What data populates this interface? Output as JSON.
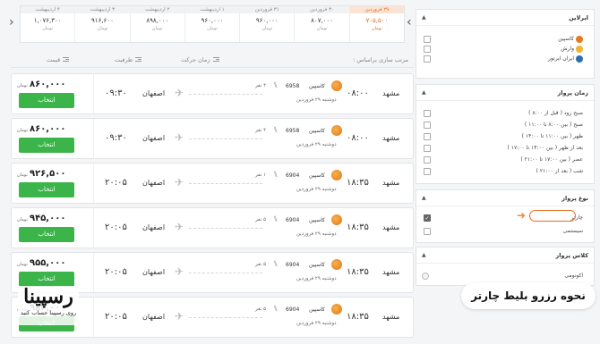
{
  "date_strip": {
    "cells": [
      {
        "date": "۲۹ فروردین",
        "price": "۷۰۵,۵۰۰",
        "currency": "تومان",
        "active": true
      },
      {
        "date": "۳۰ فروردین",
        "price": "۸۰۷,۰۰۰",
        "currency": "تومان",
        "active": false
      },
      {
        "date": "۳۱ فروردین",
        "price": "۹۶۰,۰۰۰",
        "currency": "تومان",
        "active": false
      },
      {
        "date": "۱ اردیبهشت",
        "price": "۹۶۰,۰۰۰",
        "currency": "تومان",
        "active": false
      },
      {
        "date": "۲ اردیبهشت",
        "price": "۸۹۸,۰۰۰",
        "currency": "تومان",
        "active": false
      },
      {
        "date": "۳ اردیبهشت",
        "price": "۹۱۶,۶۰۰",
        "currency": "تومان",
        "active": false
      },
      {
        "date": "۴ اردیبهشت",
        "price": "۱,۰۷۶,۳۰۰",
        "currency": "تومان",
        "active": false
      }
    ]
  },
  "sort": {
    "label": "مرتب سازی براساس :",
    "options": [
      "زمان حرکت",
      "ظرفیت",
      "قیمت"
    ]
  },
  "flights": [
    {
      "dep_time": "۰۸:۰۰",
      "dep_city": "مشهد",
      "arr_time": "۰۹:۳۰",
      "arr_city": "اصفهان",
      "airline": "کاسپین",
      "flight_no": "6958",
      "seats": "۴ نفر",
      "date": "دوشنبه ۲۹ فروردین",
      "price": "۸۶۰,۰۰۰",
      "currency": "تومان",
      "button": "انتخاب"
    },
    {
      "dep_time": "۰۸:۰۰",
      "dep_city": "مشهد",
      "arr_time": "۰۹:۳۰",
      "arr_city": "اصفهان",
      "airline": "کاسپین",
      "flight_no": "6958",
      "seats": "۴ نفر",
      "date": "دوشنبه ۲۹ فروردین",
      "price": "۸۶۰,۰۰۰",
      "currency": "تومان",
      "button": "انتخاب"
    },
    {
      "dep_time": "۱۸:۳۵",
      "dep_city": "مشهد",
      "arr_time": "۲۰:۰۵",
      "arr_city": "اصفهان",
      "airline": "کاسپین",
      "flight_no": "6904",
      "seats": "۱ نفر",
      "date": "دوشنبه ۲۹ فروردین",
      "price": "۹۲۶,۵۰۰",
      "currency": "تومان",
      "button": "انتخاب"
    },
    {
      "dep_time": "۱۸:۳۵",
      "dep_city": "مشهد",
      "arr_time": "۲۰:۰۵",
      "arr_city": "اصفهان",
      "airline": "کاسپین",
      "flight_no": "6904",
      "seats": "۵ نفر",
      "date": "دوشنبه ۲۹ فروردین",
      "price": "۹۴۵,۰۰۰",
      "currency": "تومان",
      "button": "انتخاب"
    },
    {
      "dep_time": "۱۸:۳۵",
      "dep_city": "مشهد",
      "arr_time": "۲۰:۰۵",
      "arr_city": "اصفهان",
      "airline": "کاسپین",
      "flight_no": "6904",
      "seats": "۵ نفر",
      "date": "دوشنبه ۲۹ فروردین",
      "price": "۹۵۵,۰۰۰",
      "currency": "تومان",
      "button": "انتخاب"
    },
    {
      "dep_time": "۱۸:۳۵",
      "dep_city": "مشهد",
      "arr_time": "۲۰:۰۵",
      "arr_city": "اصفهان",
      "airline": "کاسپین",
      "flight_no": "6904",
      "seats": "۵ نفر",
      "date": "دوشنبه ۲۹ فروردین",
      "price": "۹۸۳,۰۰۰",
      "currency": "تومان",
      "button": "انتخاب"
    }
  ],
  "filters": {
    "airlines": {
      "title": "ایرلاین",
      "items": [
        {
          "label": "کاسپین",
          "logo_color": "#e67a22"
        },
        {
          "label": "وارش",
          "logo_color": "#f2b233"
        },
        {
          "label": "ایران ایرتور",
          "logo_color": "#2f6db3"
        }
      ]
    },
    "time": {
      "title": "زمان پرواز",
      "items": [
        "صبح زود ( قبل از ۸:۰۰ )",
        "صبح ( بین ۸:۰۰ تا ۱۱:۰۰ )",
        "ظهر ( بین ۱۱:۰۰ تا ۱۴:۰۰ )",
        "بعد از ظهر ( بین ۱۴:۰۰ تا ۱۷:۰۰ )",
        "عصر ( بین ۱۷:۰۰ تا ۲۱:۰۰ )",
        "شب ( بعد از ۲۱:۰۰ )"
      ]
    },
    "flight_type": {
      "title": "نوع پرواز",
      "items": [
        {
          "label": "چارتر",
          "checked": true
        },
        {
          "label": "سیستمی",
          "checked": false
        }
      ]
    },
    "flight_class": {
      "title": "کلاس پرواز",
      "items": [
        "اکونومی"
      ]
    }
  },
  "banner": {
    "title": "نحوه رزرو بلیط چارتر"
  },
  "watermark": {
    "brand": "رسپینا",
    "tagline": "روی رسپینا حساب کنید"
  },
  "colors": {
    "accent": "#e46b1f",
    "button": "#3bb54a"
  }
}
